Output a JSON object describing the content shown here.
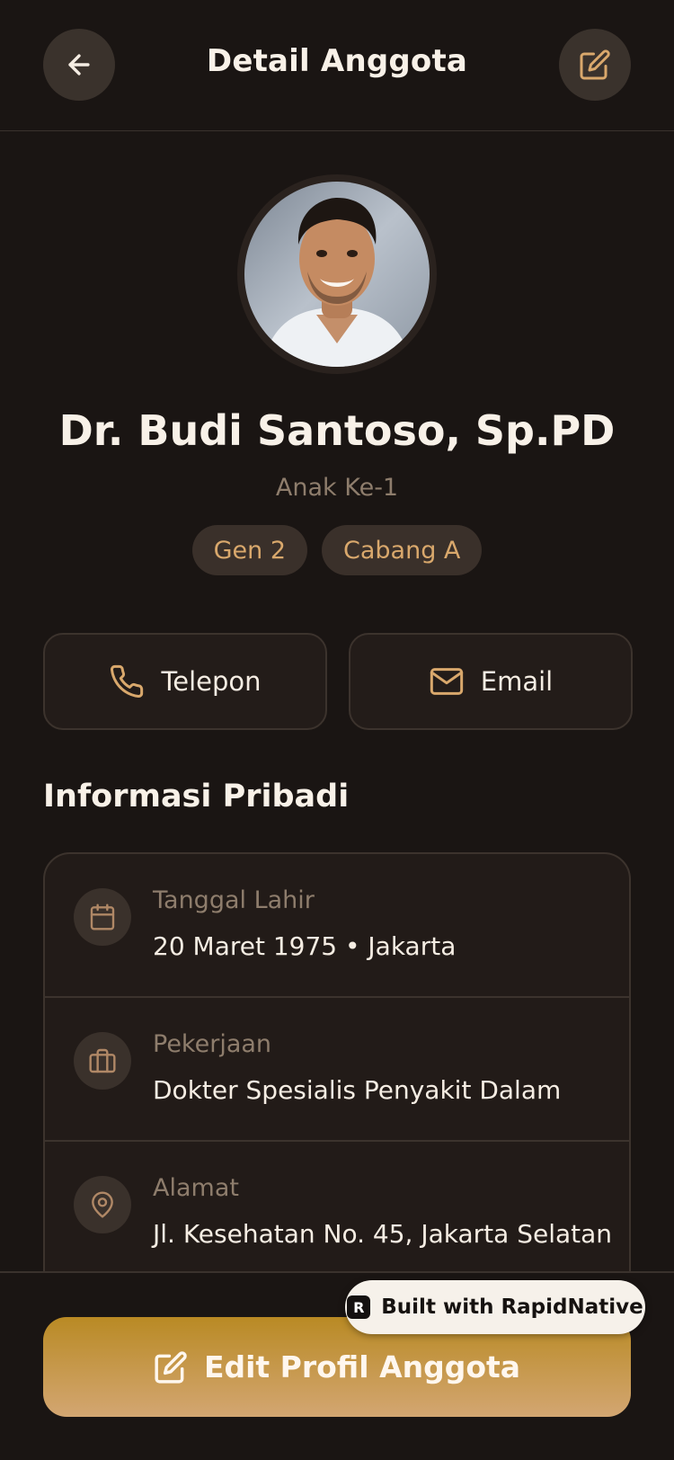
{
  "header": {
    "title": "Detail Anggota",
    "back_icon": "arrow-left-icon",
    "edit_icon": "edit-icon"
  },
  "profile": {
    "name": "Dr. Budi Santoso, Sp.PD",
    "relation": "Anak Ke-1",
    "chips": [
      "Gen 2",
      "Cabang A"
    ]
  },
  "actions": {
    "phone_label": "Telepon",
    "email_label": "Email"
  },
  "personal_info": {
    "title": "Informasi Pribadi",
    "items": [
      {
        "label": "Tanggal Lahir",
        "value": "20 Maret 1975 • Jakarta",
        "icon": "calendar-icon"
      },
      {
        "label": "Pekerjaan",
        "value": "Dokter Spesialis Penyakit Dalam",
        "icon": "briefcase-icon"
      },
      {
        "label": "Alamat",
        "value": "Jl. Kesehatan No. 45, Jakarta Selatan",
        "icon": "map-pin-icon"
      }
    ]
  },
  "footer": {
    "edit_button_label": "Edit Profil Anggota",
    "badge_label": "Built with RapidNative"
  },
  "colors": {
    "background": "#1a1513",
    "accent": "#d9a86c",
    "button_gradient_start": "#b98a24",
    "button_gradient_end": "#d3a672"
  }
}
